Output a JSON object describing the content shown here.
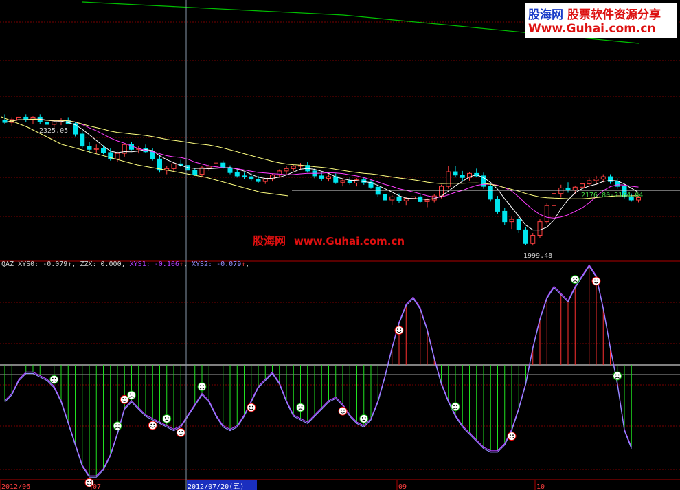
{
  "watermark": {
    "site_cn": "股海网",
    "tagline_cn": "股票软件资源分享",
    "url": "Www.Guhai.com.cn",
    "mid_cn": "股海网",
    "mid_url": "www.Guhai.com.cn"
  },
  "colors": {
    "background": "#000000",
    "grid": "#7a0000",
    "up": "#ff4040",
    "down": "#00e5ee",
    "ma_white": "#ffffff",
    "ma_magenta": "#ff3cff",
    "ma_yellow": "#ffff80",
    "ma_green": "#00c000",
    "cursor": "#8899aa",
    "osc_pos": "#ff3030",
    "osc_neg": "#20e020"
  },
  "price_panel": {
    "high_label": "2325.05",
    "low_label": "1999.48",
    "range_label": "2176.80-2164.04"
  },
  "indicator": {
    "header": [
      {
        "text": "QAZ XYS0: -0.079↑, ZZX: 0.000, ",
        "color": "#d0d0d0"
      },
      {
        "text": "XYS1: -0.106",
        "color": "#b040ff"
      },
      {
        "text": "↑",
        "color": "#ff4040"
      },
      {
        "text": ", ",
        "color": "#d0d0d0"
      },
      {
        "text": "XYS2: -0.079",
        "color": "#9090ff"
      },
      {
        "text": "↑",
        "color": "#ff4040"
      },
      {
        "text": ",",
        "color": "#d0d0d0"
      }
    ]
  },
  "date_axis": {
    "labels": [
      "2012/06",
      "07",
      "2012/07/20(五)",
      "09",
      "10"
    ]
  },
  "chart_data": {
    "type": "candlestick",
    "instrument_high": 2325.05,
    "instrument_low": 1999.48,
    "period_label": "2012/06 – 2012/10",
    "ohlc": [
      [
        2310,
        2325,
        2300,
        2305
      ],
      [
        2305,
        2318,
        2295,
        2312
      ],
      [
        2312,
        2322,
        2300,
        2318
      ],
      [
        2318,
        2325,
        2305,
        2312
      ],
      [
        2312,
        2320,
        2300,
        2318
      ],
      [
        2318,
        2325,
        2300,
        2306
      ],
      [
        2306,
        2315,
        2295,
        2300
      ],
      [
        2300,
        2310,
        2292,
        2306
      ],
      [
        2306,
        2316,
        2298,
        2310
      ],
      [
        2310,
        2318,
        2300,
        2302
      ],
      [
        2302,
        2306,
        2270,
        2276
      ],
      [
        2276,
        2285,
        2240,
        2246
      ],
      [
        2246,
        2256,
        2230,
        2238
      ],
      [
        2238,
        2250,
        2228,
        2240
      ],
      [
        2240,
        2248,
        2226,
        2230
      ],
      [
        2230,
        2240,
        2210,
        2214
      ],
      [
        2214,
        2232,
        2208,
        2228
      ],
      [
        2228,
        2252,
        2220,
        2250
      ],
      [
        2250,
        2256,
        2236,
        2238
      ],
      [
        2238,
        2246,
        2228,
        2240
      ],
      [
        2240,
        2250,
        2230,
        2232
      ],
      [
        2232,
        2240,
        2210,
        2214
      ],
      [
        2214,
        2222,
        2180,
        2186
      ],
      [
        2186,
        2196,
        2176,
        2190
      ],
      [
        2190,
        2206,
        2182,
        2202
      ],
      [
        2202,
        2212,
        2194,
        2198
      ],
      [
        2198,
        2210,
        2180,
        2186
      ],
      [
        2186,
        2190,
        2172,
        2176
      ],
      [
        2176,
        2196,
        2170,
        2192
      ],
      [
        2192,
        2200,
        2184,
        2196
      ],
      [
        2196,
        2206,
        2188,
        2204
      ],
      [
        2204,
        2210,
        2190,
        2192
      ],
      [
        2192,
        2198,
        2176,
        2180
      ],
      [
        2180,
        2186,
        2168,
        2172
      ],
      [
        2172,
        2180,
        2164,
        2170
      ],
      [
        2170,
        2178,
        2160,
        2164
      ],
      [
        2164,
        2172,
        2154,
        2158
      ],
      [
        2158,
        2166,
        2152,
        2164
      ],
      [
        2164,
        2178,
        2158,
        2174
      ],
      [
        2174,
        2188,
        2168,
        2184
      ],
      [
        2184,
        2196,
        2176,
        2190
      ],
      [
        2190,
        2200,
        2184,
        2196
      ],
      [
        2196,
        2204,
        2188,
        2198
      ],
      [
        2198,
        2206,
        2180,
        2184
      ],
      [
        2184,
        2190,
        2166,
        2172
      ],
      [
        2172,
        2180,
        2160,
        2166
      ],
      [
        2166,
        2176,
        2158,
        2170
      ],
      [
        2170,
        2178,
        2152,
        2156
      ],
      [
        2156,
        2164,
        2146,
        2160
      ],
      [
        2160,
        2170,
        2150,
        2154
      ],
      [
        2154,
        2166,
        2146,
        2162
      ],
      [
        2162,
        2170,
        2150,
        2156
      ],
      [
        2156,
        2162,
        2140,
        2144
      ],
      [
        2144,
        2150,
        2120,
        2126
      ],
      [
        2126,
        2134,
        2106,
        2112
      ],
      [
        2112,
        2124,
        2100,
        2120
      ],
      [
        2120,
        2128,
        2104,
        2110
      ],
      [
        2110,
        2120,
        2098,
        2116
      ],
      [
        2116,
        2126,
        2106,
        2120
      ],
      [
        2120,
        2128,
        2104,
        2108
      ],
      [
        2108,
        2116,
        2094,
        2112
      ],
      [
        2112,
        2126,
        2106,
        2122
      ],
      [
        2122,
        2150,
        2116,
        2146
      ],
      [
        2146,
        2196,
        2140,
        2182
      ],
      [
        2182,
        2196,
        2168,
        2174
      ],
      [
        2174,
        2184,
        2158,
        2168
      ],
      [
        2168,
        2182,
        2160,
        2178
      ],
      [
        2178,
        2190,
        2170,
        2172
      ],
      [
        2172,
        2180,
        2140,
        2146
      ],
      [
        2146,
        2154,
        2108,
        2114
      ],
      [
        2114,
        2122,
        2078,
        2084
      ],
      [
        2084,
        2092,
        2050,
        2058
      ],
      [
        2058,
        2070,
        2040,
        2064
      ],
      [
        2064,
        2074,
        2030,
        2038
      ],
      [
        2038,
        2044,
        2000,
        2004
      ],
      [
        2004,
        2030,
        1999,
        2024
      ],
      [
        2024,
        2064,
        2018,
        2058
      ],
      [
        2058,
        2104,
        2052,
        2098
      ],
      [
        2098,
        2134,
        2090,
        2128
      ],
      [
        2128,
        2150,
        2118,
        2142
      ],
      [
        2142,
        2156,
        2130,
        2136
      ],
      [
        2136,
        2148,
        2126,
        2144
      ],
      [
        2144,
        2158,
        2136,
        2152
      ],
      [
        2152,
        2168,
        2144,
        2160
      ],
      [
        2160,
        2172,
        2150,
        2164
      ],
      [
        2164,
        2176,
        2156,
        2170
      ],
      [
        2170,
        2176,
        2152,
        2158
      ],
      [
        2158,
        2166,
        2140,
        2146
      ],
      [
        2146,
        2152,
        2116,
        2120
      ],
      [
        2120,
        2128,
        2108,
        2112
      ],
      [
        2112,
        2122,
        2106,
        2118
      ]
    ],
    "oscillator": {
      "series": [
        {
          "name": "XYS1",
          "color": "#b040ff"
        },
        {
          "name": "XYS2",
          "color": "#9090ff"
        }
      ],
      "values": [
        -0.1,
        -0.08,
        -0.04,
        -0.02,
        -0.02,
        -0.03,
        -0.04,
        -0.06,
        -0.1,
        -0.16,
        -0.22,
        -0.28,
        -0.31,
        -0.31,
        -0.29,
        -0.25,
        -0.19,
        -0.12,
        -0.1,
        -0.12,
        -0.14,
        -0.15,
        -0.16,
        -0.17,
        -0.18,
        -0.17,
        -0.14,
        -0.11,
        -0.08,
        -0.1,
        -0.14,
        -0.17,
        -0.18,
        -0.17,
        -0.14,
        -0.1,
        -0.06,
        -0.04,
        -0.02,
        -0.05,
        -0.1,
        -0.14,
        -0.15,
        -0.16,
        -0.14,
        -0.12,
        -0.1,
        -0.09,
        -0.11,
        -0.14,
        -0.16,
        -0.17,
        -0.15,
        -0.1,
        -0.03,
        0.05,
        0.12,
        0.17,
        0.19,
        0.16,
        0.1,
        0.02,
        -0.05,
        -0.1,
        -0.14,
        -0.17,
        -0.19,
        -0.21,
        -0.23,
        -0.24,
        -0.24,
        -0.22,
        -0.18,
        -0.12,
        -0.05,
        0.05,
        0.13,
        0.19,
        0.22,
        0.2,
        0.18,
        0.22,
        0.25,
        0.28,
        0.25,
        0.16,
        0.05,
        -0.05,
        -0.18,
        -0.23
      ]
    }
  }
}
